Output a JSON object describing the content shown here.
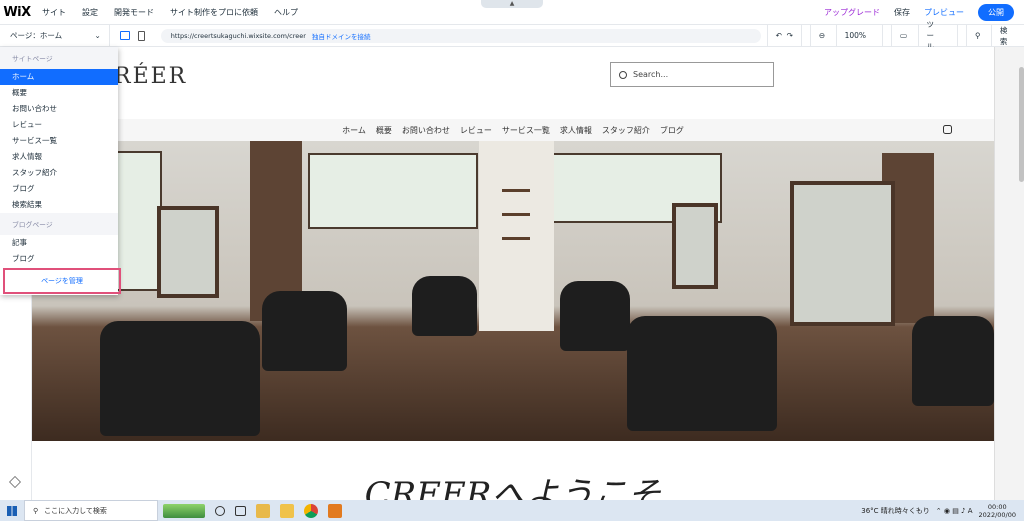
{
  "editor": {
    "logo": "WiX",
    "menu": [
      "サイト",
      "設定",
      "開発モード",
      "サイト制作をプロに依頼",
      "ヘルプ"
    ],
    "upgrade_label": "アップグレード",
    "save_label": "保存",
    "preview_label": "プレビュー",
    "publish_label": "公開",
    "notch_label": "▲"
  },
  "subbar": {
    "page_label": "ページ：ホーム",
    "url": "https://creertsukaguchi.wixsite.com/creer",
    "domain_link": "独自ドメインを接続",
    "zoom": "100%",
    "tools_label": "ツール",
    "search_label": "検索"
  },
  "pages_panel": {
    "site_pages_title": "サイトページ",
    "site_pages": [
      "ホーム",
      "概要",
      "お問い合わせ",
      "レビュー",
      "サービス一覧",
      "求人情報",
      "スタッフ紹介",
      "ブログ",
      "検索結果"
    ],
    "active_index": 0,
    "blog_pages_title": "ブログページ",
    "blog_pages": [
      "記事",
      "ブログ"
    ],
    "manage_label": "ページを管理"
  },
  "site": {
    "logo_text": "RÉER",
    "search_placeholder": "Search...",
    "nav_items": [
      "ホーム",
      "概要",
      "お問い合わせ",
      "レビュー",
      "サービス一覧",
      "求人情報",
      "スタッフ紹介",
      "ブログ"
    ],
    "welcome": "CREERへようこそ"
  },
  "taskbar": {
    "search_placeholder": "ここに入力して検索",
    "weather": "36°C 晴れ時々くもり",
    "time": "00:00",
    "date": "2022/00/00"
  },
  "colors": {
    "accent": "#116dff",
    "upgrade": "#9a27d5",
    "highlight_box": "#e0507a"
  }
}
